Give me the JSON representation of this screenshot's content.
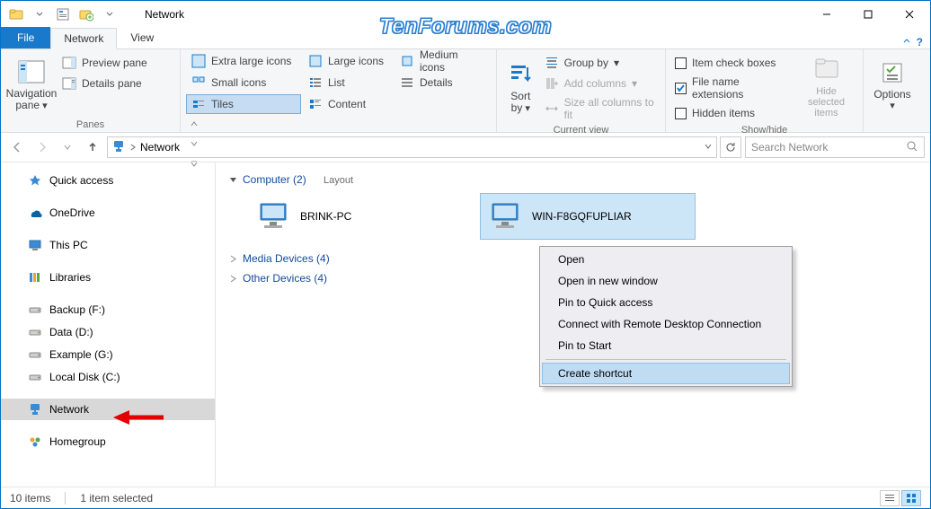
{
  "colors": {
    "accent": "#1979ca",
    "selection": "#cde6f7",
    "selection_border": "#8cc0e8"
  },
  "watermark": "TenForums.com",
  "title": "Network",
  "window_controls": {
    "minimize": "—",
    "maximize": "☐",
    "close": "✕"
  },
  "tabstrip": {
    "file": "File",
    "tabs": [
      {
        "label": "Network",
        "active": true
      },
      {
        "label": "View",
        "active": false
      }
    ],
    "help_icon": "?"
  },
  "ribbon": {
    "panes": {
      "group_label": "Panes",
      "navigation_pane": "Navigation pane",
      "preview_pane": "Preview pane",
      "details_pane": "Details pane"
    },
    "layout": {
      "group_label": "Layout",
      "items": [
        {
          "label": "Extra large icons",
          "active": false
        },
        {
          "label": "Large icons",
          "active": false
        },
        {
          "label": "Medium icons",
          "active": false
        },
        {
          "label": "Small icons",
          "active": false
        },
        {
          "label": "List",
          "active": false
        },
        {
          "label": "Details",
          "active": false
        },
        {
          "label": "Tiles",
          "active": true
        },
        {
          "label": "Content",
          "active": false
        }
      ]
    },
    "current_view": {
      "group_label": "Current view",
      "sort_by": "Sort by",
      "group_by": "Group by",
      "add_columns": "Add columns",
      "size_columns": "Size all columns to fit"
    },
    "show_hide": {
      "group_label": "Show/hide",
      "item_checkboxes": {
        "label": "Item check boxes",
        "checked": false
      },
      "file_ext": {
        "label": "File name extensions",
        "checked": true
      },
      "hidden_items": {
        "label": "Hidden items",
        "checked": false
      },
      "hide_selected": "Hide selected items"
    },
    "options": "Options"
  },
  "address": {
    "breadcrumb": [
      "Network"
    ],
    "refresh_icon": "refresh-icon"
  },
  "search": {
    "placeholder": "Search Network"
  },
  "nav_pane": {
    "items": [
      {
        "label": "Quick access",
        "icon": "quickaccess-icon",
        "selected": false,
        "group": 0
      },
      {
        "label": "OneDrive",
        "icon": "onedrive-icon",
        "selected": false,
        "group": 1
      },
      {
        "label": "This PC",
        "icon": "thispc-icon",
        "selected": false,
        "group": 2
      },
      {
        "label": "Libraries",
        "icon": "libraries-icon",
        "selected": false,
        "group": 3
      },
      {
        "label": "Backup (F:)",
        "icon": "drive-icon",
        "selected": false,
        "group": 4
      },
      {
        "label": "Data (D:)",
        "icon": "drive-icon",
        "selected": false,
        "group": 4
      },
      {
        "label": "Example (G:)",
        "icon": "drive-icon",
        "selected": false,
        "group": 4
      },
      {
        "label": "Local Disk (C:)",
        "icon": "drive-icon",
        "selected": false,
        "group": 4
      },
      {
        "label": "Network",
        "icon": "network-icon",
        "selected": true,
        "group": 5
      },
      {
        "label": "Homegroup",
        "icon": "homegroup-icon",
        "selected": false,
        "group": 6
      }
    ]
  },
  "content": {
    "categories": [
      {
        "label": "Computer (2)",
        "expanded": true
      },
      {
        "label": "Media Devices (4)",
        "expanded": false
      },
      {
        "label": "Other Devices (4)",
        "expanded": false
      }
    ],
    "computers": [
      {
        "label": "BRINK-PC",
        "selected": false
      },
      {
        "label": "WIN-F8GQFUPLIAR",
        "selected": true
      }
    ]
  },
  "context_menu": {
    "items": [
      {
        "label": "Open"
      },
      {
        "label": "Open in new window"
      },
      {
        "label": "Pin to Quick access"
      },
      {
        "label": "Connect with Remote Desktop Connection"
      },
      {
        "label": "Pin to Start"
      },
      {
        "sep": true
      },
      {
        "label": "Create shortcut",
        "hover": true
      }
    ]
  },
  "statusbar": {
    "count": "10 items",
    "selected": "1 item selected"
  }
}
